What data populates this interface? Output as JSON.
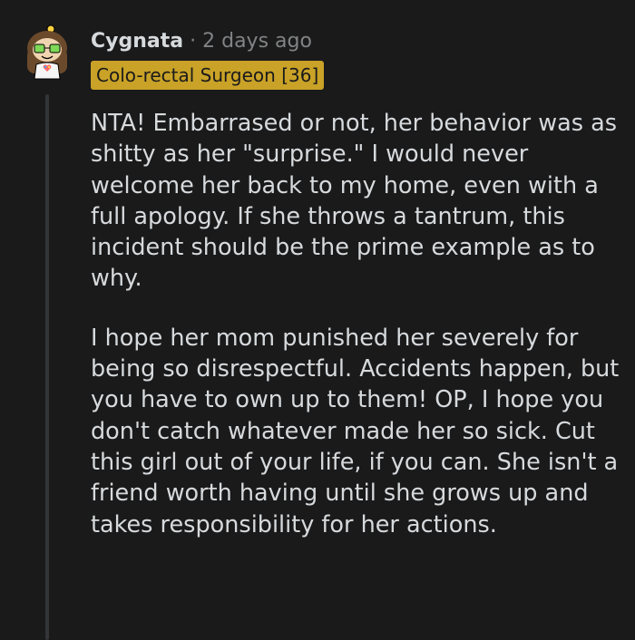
{
  "comment": {
    "author": "Cygnata",
    "separator": "·",
    "timestamp": "2 days ago",
    "flair": "Colo-rectal Surgeon [36]",
    "paragraphs": [
      "NTA! Embarrased or not, her behavior was as shitty as her \"surprise.\" I would never welcome her back to my home, even with a full apology. If she throws a tantrum, this incident should be the prime example as to why.",
      "I hope her mom punished her severely for being so disrespectful. Accidents happen, but you have to own up to them! OP, I hope you don't catch whatever made her so sick. Cut this girl out of your life, if you can. She isn't a friend worth having until she grows up and takes responsibility for her actions."
    ]
  },
  "colors": {
    "background": "#1a1a1b",
    "text": "#d7dadc",
    "muted": "#818384",
    "flair_bg": "#c9a227",
    "thread_line": "#343536"
  },
  "icons": {
    "avatar": "snoo-avatar-icon"
  }
}
